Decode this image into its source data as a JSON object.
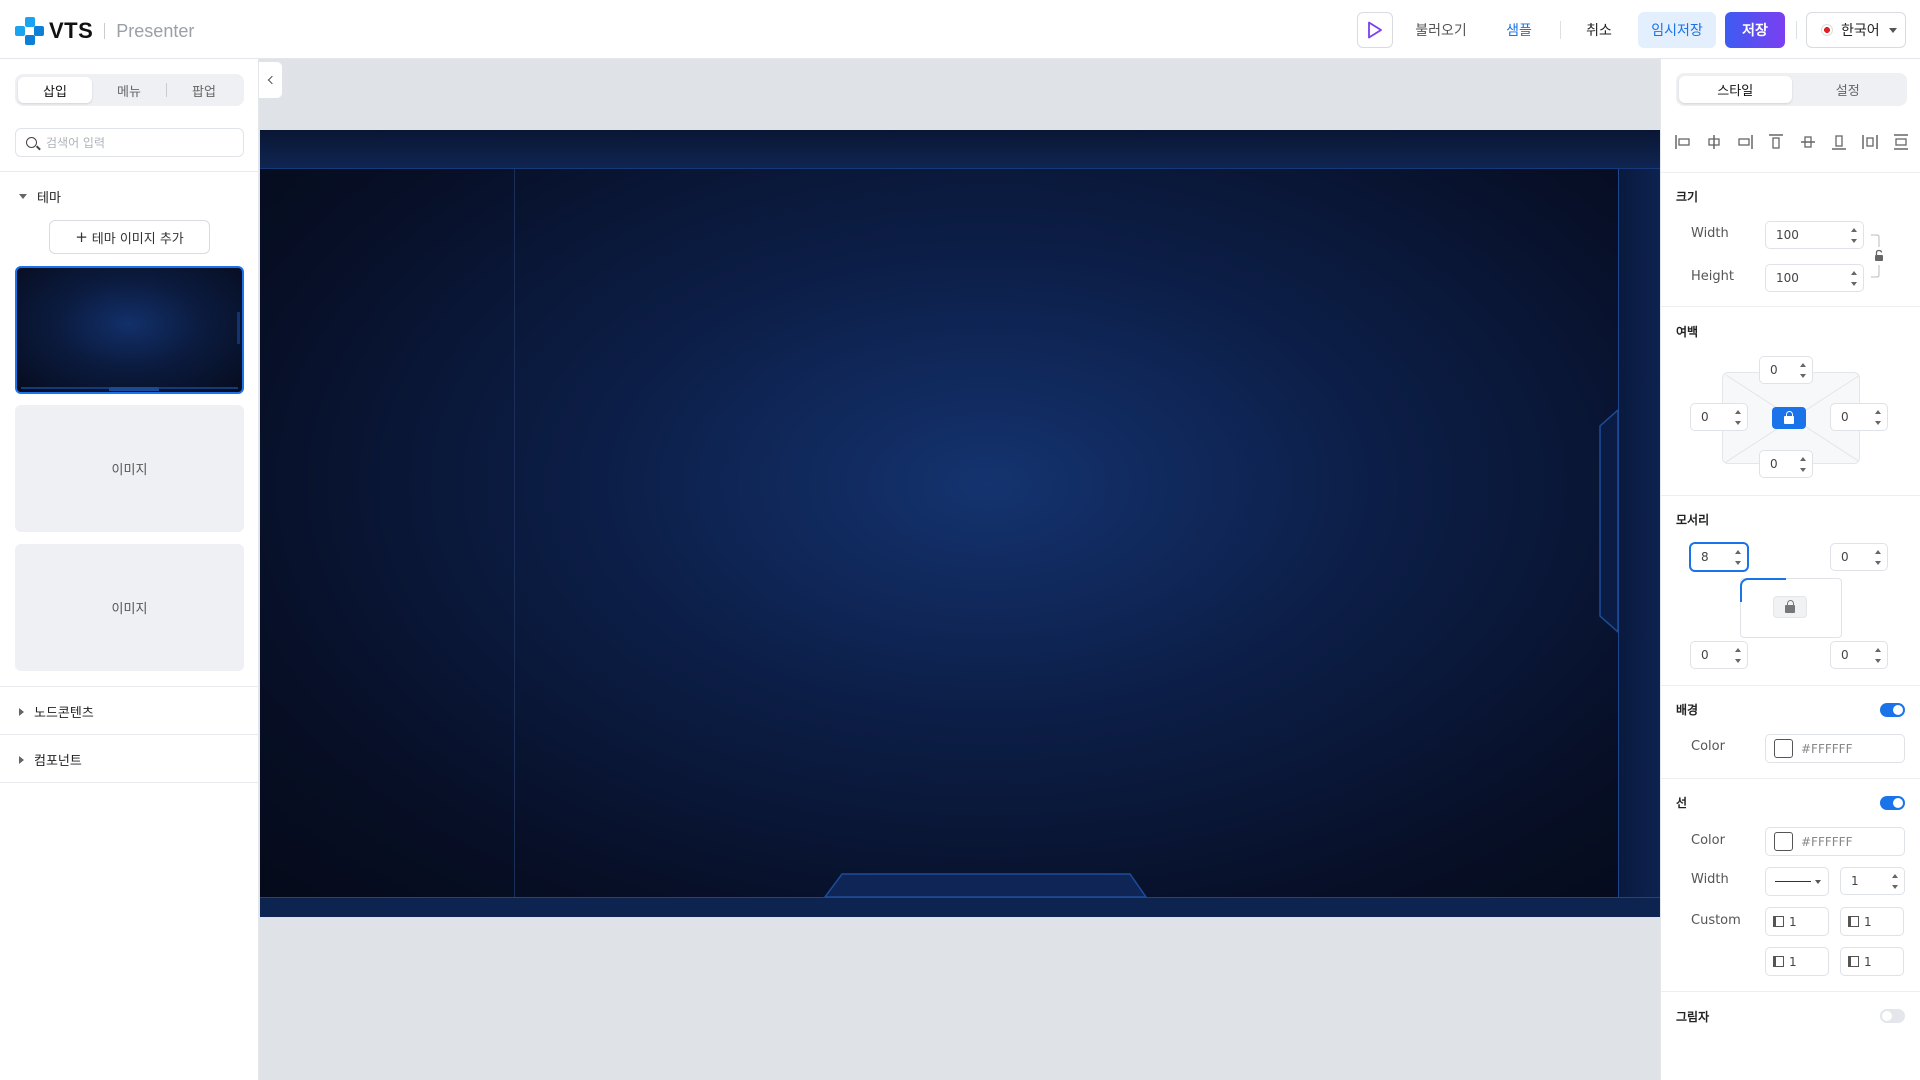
{
  "header": {
    "brand": "VTS",
    "product": "Presenter",
    "load_label": "불러오기",
    "sample_label": "샘플",
    "cancel_label": "취소",
    "temp_save_label": "임시저장",
    "save_label": "저장",
    "language": "한국어"
  },
  "left_panel": {
    "tabs": [
      "삽입",
      "메뉴",
      "팝업"
    ],
    "active_tab": "삽입",
    "search_placeholder": "검색어 입력",
    "sections": {
      "theme": "테마",
      "node_contents": "노드콘텐츠",
      "components": "컴포넌트"
    },
    "add_theme_label": "테마 이미지 추가",
    "image_items": [
      "이미지",
      "이미지"
    ]
  },
  "right_panel": {
    "tabs": [
      "스타일",
      "설정"
    ],
    "active_tab": "스타일",
    "size": {
      "title": "크기",
      "width_label": "Width",
      "width_value": "100",
      "height_label": "Height",
      "height_value": "100"
    },
    "padding": {
      "title": "여백",
      "top": "0",
      "left": "0",
      "right": "0",
      "bottom": "0"
    },
    "corner": {
      "title": "모서리",
      "top_left": "8",
      "top_right": "0",
      "bottom_left": "0",
      "bottom_right": "0"
    },
    "background": {
      "title": "배경",
      "enabled": true,
      "color_label": "Color",
      "color_value": "#FFFFFF"
    },
    "border": {
      "title": "선",
      "enabled": true,
      "color_label": "Color",
      "color_value": "#FFFFFF",
      "width_label": "Width",
      "width_value": "1",
      "custom_label": "Custom",
      "custom_values": [
        "1",
        "1",
        "1",
        "1"
      ]
    },
    "shadow": {
      "title": "그림자",
      "enabled": false
    }
  },
  "colors": {
    "accent": "#1a73e8",
    "save_gradient_start": "#3d5cf2",
    "save_gradient_end": "#7b3ff0",
    "canvas_background": "#0c1e47"
  },
  "icons": [
    "play-icon",
    "search-icon",
    "chevron-left-icon",
    "lock-icon",
    "unlock-icon",
    "align-left-icon",
    "align-center-icon",
    "align-right-icon",
    "align-top-icon",
    "align-middle-icon",
    "align-bottom-icon",
    "distribute-horizontal-icon",
    "distribute-vertical-icon"
  ]
}
